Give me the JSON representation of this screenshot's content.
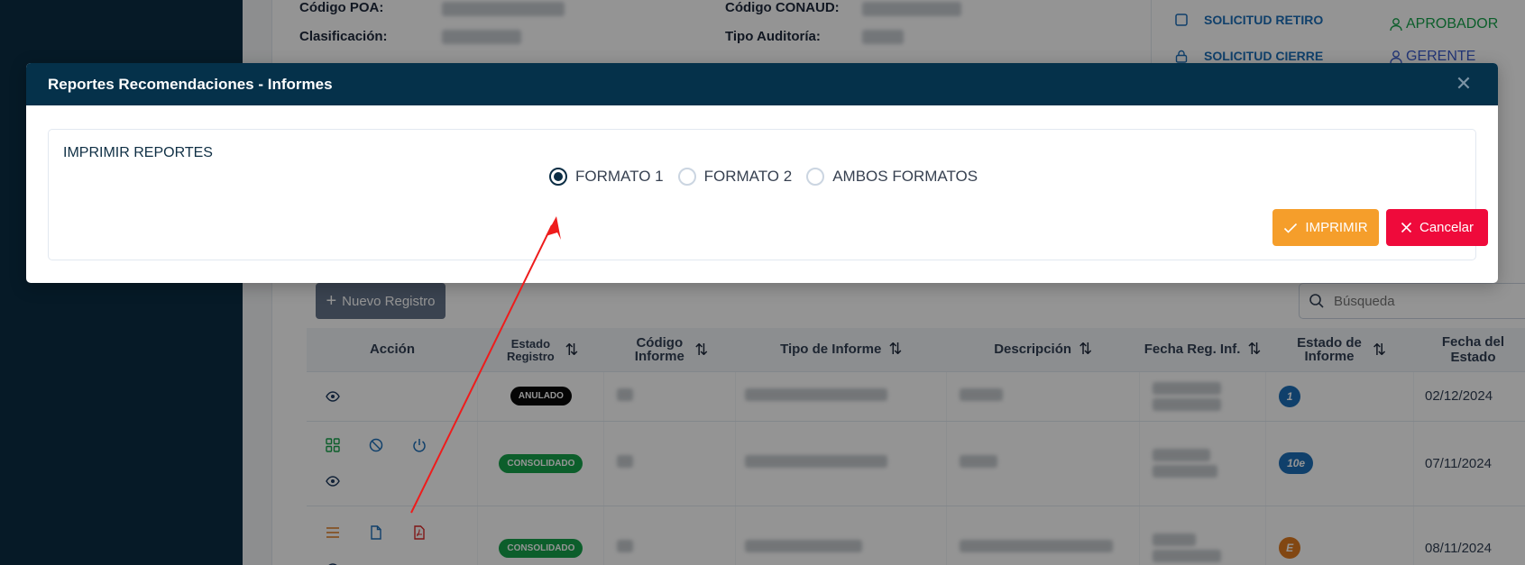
{
  "background": {
    "info_labels": [
      "Código POA:",
      "Clasificación:",
      "Código CONAUD:",
      "Tipo Auditoría:"
    ],
    "side_panel": {
      "items": [
        "SOLICITUD RETIRO",
        "SOLICITUD CIERRE"
      ],
      "roles": [
        "APROBADOR",
        "GERENTE"
      ]
    },
    "new_record_label": "Nuevo Registro",
    "search_placeholder": "Búsqueda",
    "table": {
      "headers": {
        "accion": "Acción",
        "estado_registro": "Estado Registro",
        "codigo_informe": "Código Informe",
        "tipo_informe": "Tipo de Informe",
        "descripcion": "Descripción",
        "fecha_reg": "Fecha Reg. Inf.",
        "estado_informe": "Estado de Informe",
        "fecha_estado": "Fecha del Estado"
      },
      "rows": [
        {
          "estado": "ANULADO",
          "estado_color": "#0a0a0a",
          "informe_badge": "1",
          "informe_color": "#1d6fb8",
          "fecha_estado": "02/12/2024"
        },
        {
          "estado": "CONSOLIDADO",
          "estado_color": "#16a34a",
          "informe_badge": "10e",
          "informe_color": "#1d6fb8",
          "fecha_estado": "07/11/2024"
        },
        {
          "estado": "CONSOLIDADO",
          "estado_color": "#16a34a",
          "informe_badge": "E",
          "informe_color": "#e07b20",
          "fecha_estado": "08/11/2024"
        }
      ]
    }
  },
  "modal": {
    "title": "Reportes Recomendaciones - Informes",
    "section_title": "IMPRIMIR REPORTES",
    "options": [
      {
        "label": "FORMATO 1",
        "checked": true
      },
      {
        "label": "FORMATO 2",
        "checked": false
      },
      {
        "label": "AMBOS FORMATOS",
        "checked": false
      }
    ],
    "print_label": "IMPRIMIR",
    "cancel_label": "Cancelar",
    "close_icon": "close-icon"
  },
  "colors": {
    "sidebar": "#0b2d44",
    "modal_header": "#05314a",
    "print_button": "#f59e2b",
    "cancel_button": "#ef0a3b",
    "annotation_arrow": "#ee1c1c"
  }
}
